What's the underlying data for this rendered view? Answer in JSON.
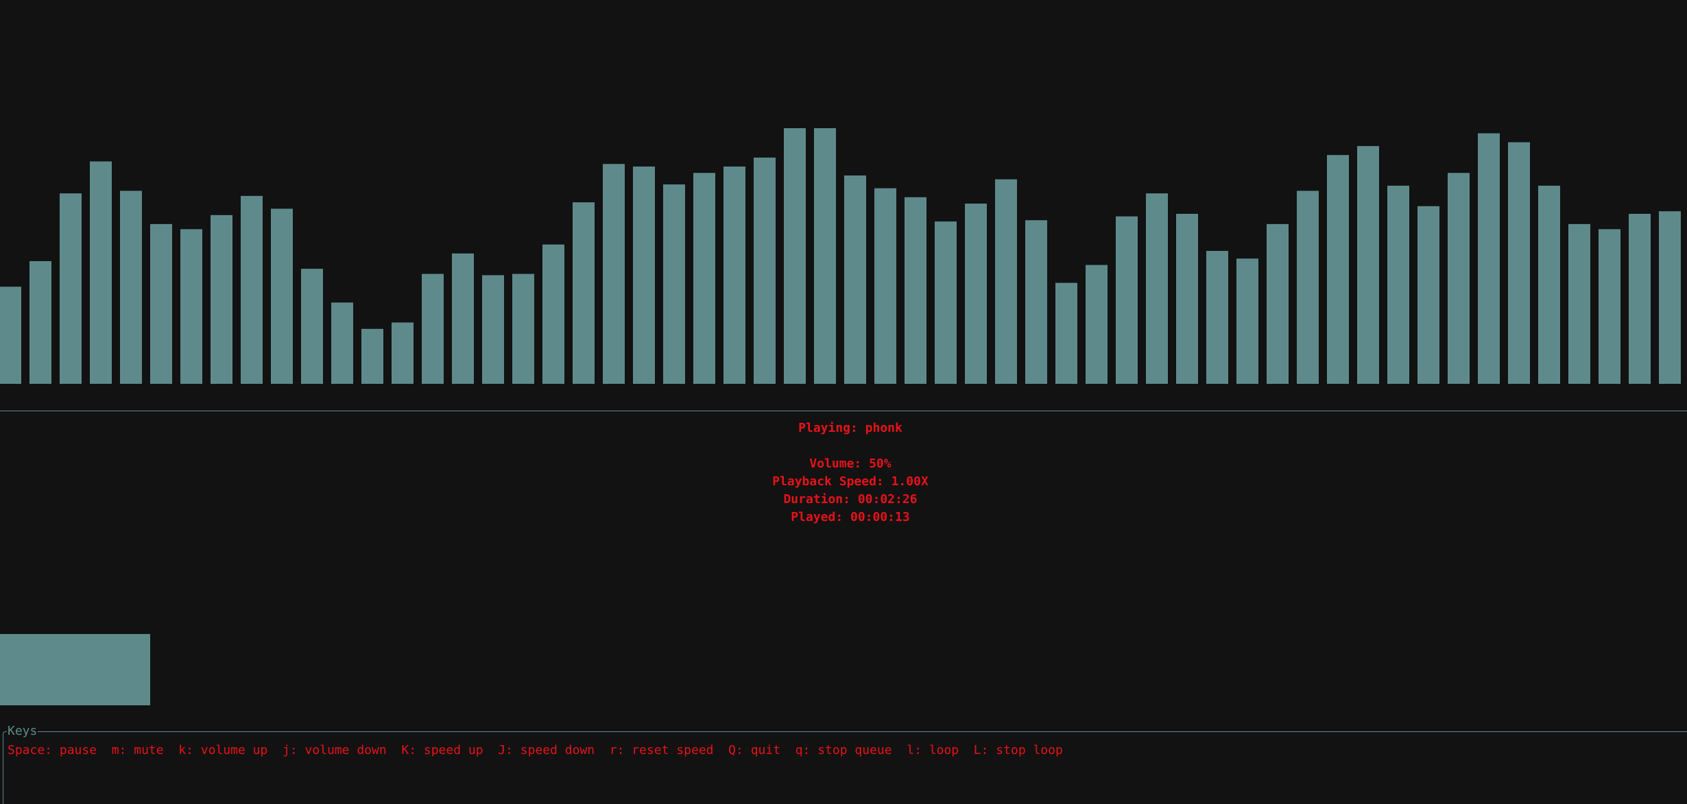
{
  "colors": {
    "background": "#121212",
    "bar": "#5f8a8b",
    "text": "#e8121a",
    "border": "#5f8a8b"
  },
  "visualizer": {
    "levels": [
      0.38,
      0.48,
      0.745,
      0.87,
      0.755,
      0.625,
      0.605,
      0.66,
      0.735,
      0.685,
      0.45,
      0.318,
      0.215,
      0.24,
      0.43,
      0.51,
      0.425,
      0.43,
      0.545,
      0.71,
      0.86,
      0.85,
      0.78,
      0.825,
      0.85,
      0.885,
      1.0,
      1.0,
      0.815,
      0.765,
      0.73,
      0.635,
      0.705,
      0.8,
      0.64,
      0.395,
      0.465,
      0.655,
      0.745,
      0.665,
      0.52,
      0.49,
      0.625,
      0.755,
      0.895,
      0.93,
      0.775,
      0.695,
      0.825,
      0.98,
      0.945,
      0.775,
      0.625,
      0.605,
      0.665,
      0.675
    ]
  },
  "player": {
    "playing_line": "Playing: phonk",
    "volume_line": "Volume: 50%",
    "speed_line": "Playback Speed: 1.00X",
    "duration_line": "Duration: 00:02:26",
    "played_line": "Played: 00:00:13",
    "progress_fraction": 0.089
  },
  "keys": {
    "title": "Keys",
    "hint": "Space: pause  m: mute  k: volume up  j: volume down  K: speed up  J: speed down  r: reset speed  Q: quit  q: stop queue  l: loop  L: stop loop"
  }
}
